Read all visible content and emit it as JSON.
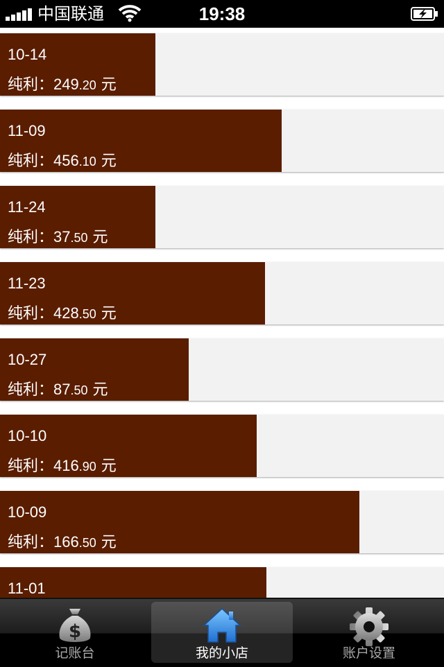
{
  "status_bar": {
    "carrier": "中国联通",
    "time": "19:38"
  },
  "list": {
    "rows": [
      {
        "date": "10-14",
        "profit_label": "纯利：",
        "profit_int": "249",
        "profit_dec": ".20",
        "unit": " 元",
        "bar_fraction": 0.35
      },
      {
        "date": "11-09",
        "profit_label": "纯利：",
        "profit_int": "456",
        "profit_dec": ".10",
        "unit": " 元",
        "bar_fraction": 0.634
      },
      {
        "date": "11-24",
        "profit_label": "纯利：",
        "profit_int": "37",
        "profit_dec": ".50",
        "unit": " 元",
        "bar_fraction": 0.35
      },
      {
        "date": "11-23",
        "profit_label": "纯利：",
        "profit_int": "428",
        "profit_dec": ".50",
        "unit": " 元",
        "bar_fraction": 0.597
      },
      {
        "date": "10-27",
        "profit_label": "纯利：",
        "profit_int": "87",
        "profit_dec": ".50",
        "unit": " 元",
        "bar_fraction": 0.425
      },
      {
        "date": "10-10",
        "profit_label": "纯利：",
        "profit_int": "416",
        "profit_dec": ".90",
        "unit": " 元",
        "bar_fraction": 0.578
      },
      {
        "date": "10-09",
        "profit_label": "纯利：",
        "profit_int": "166",
        "profit_dec": ".50",
        "unit": " 元",
        "bar_fraction": 0.809
      },
      {
        "date": "11-01",
        "profit_label": "",
        "profit_int": "",
        "profit_dec": "",
        "unit": "",
        "bar_fraction": 0.6
      }
    ]
  },
  "tab_bar": {
    "tabs": [
      {
        "label": "记账台",
        "icon": "money-bag-icon",
        "active": false
      },
      {
        "label": "我的小店",
        "icon": "home-icon",
        "active": true
      },
      {
        "label": "账户设置",
        "icon": "gear-icon",
        "active": false
      }
    ]
  },
  "colors": {
    "bar": "#5a1d00",
    "row_bg": "#f2f2f2",
    "active_icon": "#2a8be0"
  }
}
